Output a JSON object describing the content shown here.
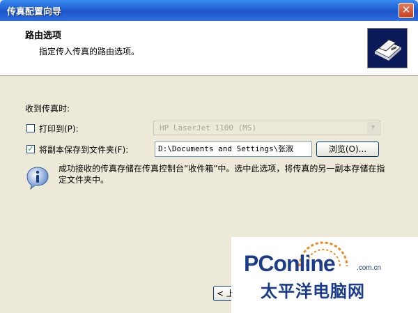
{
  "window": {
    "title": "传真配置向导",
    "close_label": "✕"
  },
  "header": {
    "title": "路由选项",
    "subtitle": "指定传入传真的路由选项。",
    "icon": "fax-machine-icon"
  },
  "body": {
    "receive_label": "收到传真时:",
    "print_option": {
      "label": "打印到(P):",
      "checked": false,
      "printer_value": "HP LaserJet 1100 (MS)"
    },
    "save_option": {
      "label": "将副本保存到文件夹(F):",
      "checked": true,
      "path_value": "D:\\Documents and Settings\\张淑",
      "browse_label": "浏览(O)..."
    },
    "info_icon": "info-icon",
    "info_text": "成功接收的传真存储在传真控制台“收件箱”中。选中此选项，将传真的另一副本存储在指定文件夹中。"
  },
  "footer": {
    "back_label": "< 上"
  },
  "watermark": {
    "logo": "PConline",
    "domain": ".com.cn",
    "chinese": "太平洋电脑网"
  },
  "colors": {
    "titlebar": "#1f5fd1",
    "accent_check": "#21a121",
    "watermark": "#1a3c8a",
    "orange": "#f08a1d"
  }
}
